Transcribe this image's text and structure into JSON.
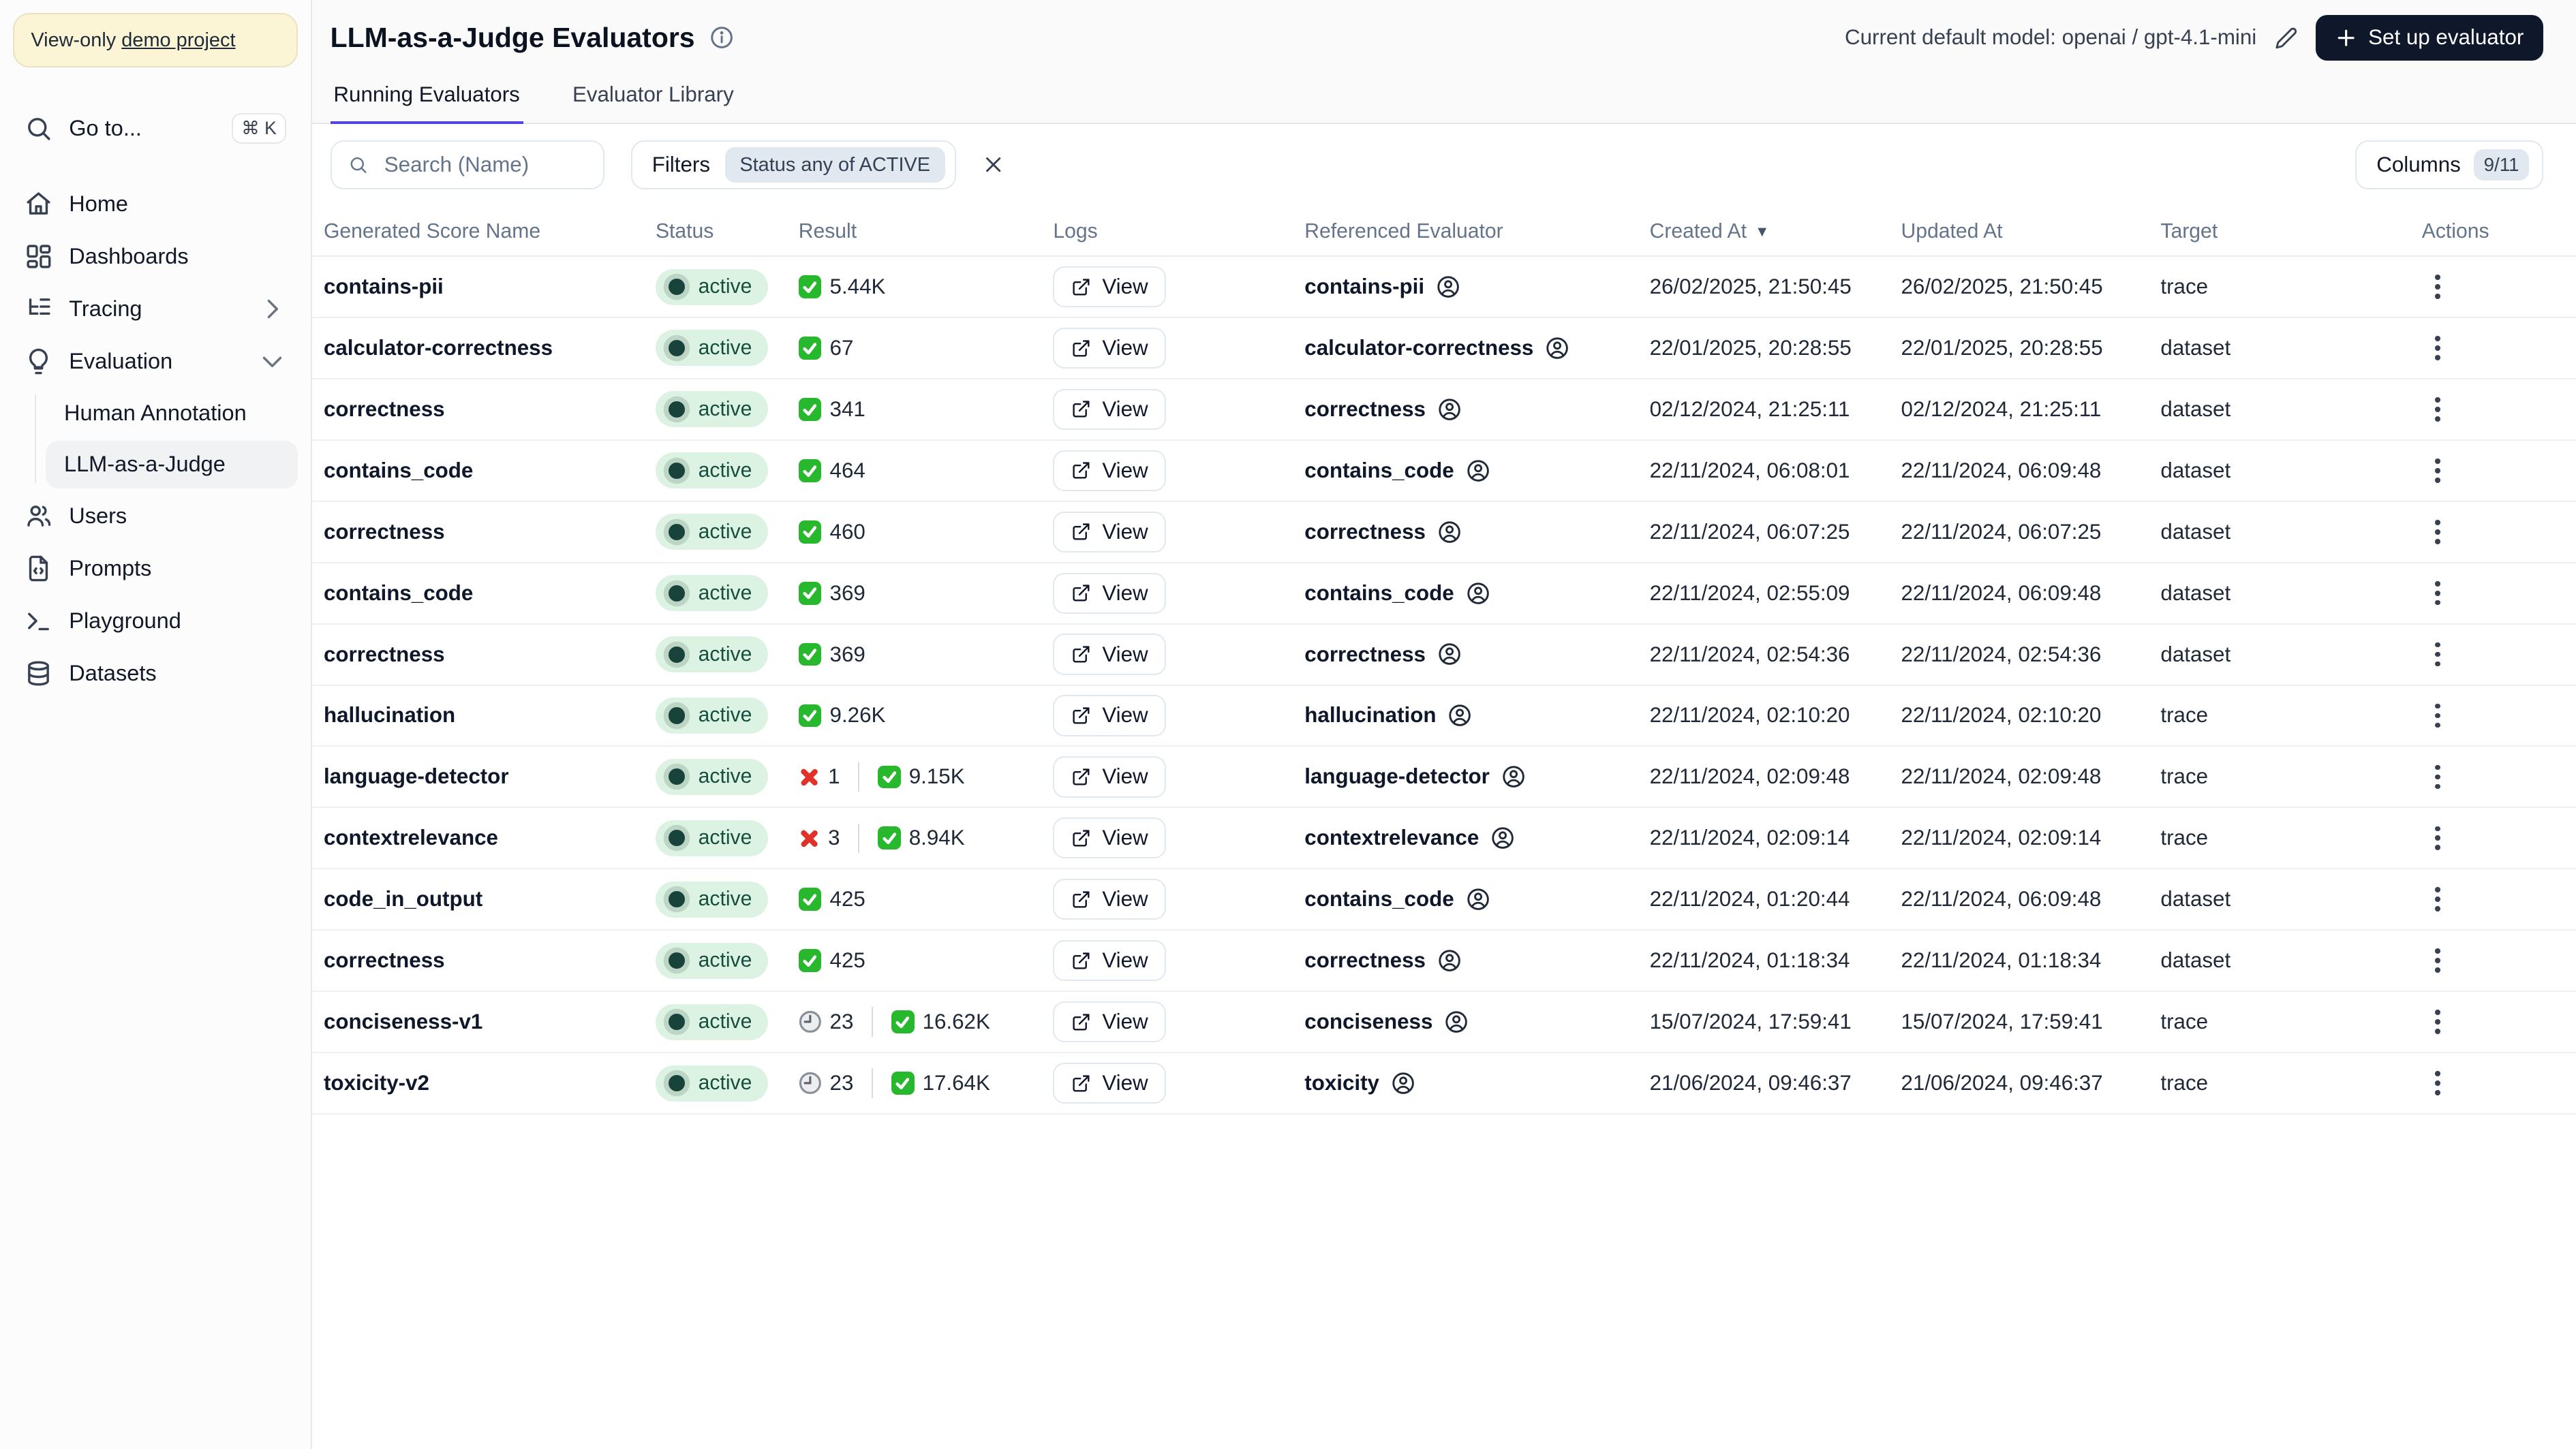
{
  "colors": {
    "accent": "#4f46e5",
    "status_active_bg": "#dcf3e4",
    "status_active_text": "#174f3f",
    "success_green": "#28b82e",
    "error_red": "#e0312a",
    "primary_button_bg": "#0f172a",
    "banner_bg": "#fbf4d5"
  },
  "sidebar": {
    "banner_text": "View-only",
    "banner_link": "demo project",
    "goto_label": "Go to...",
    "goto_shortcut": "⌘ K",
    "items": [
      {
        "label": "Home"
      },
      {
        "label": "Dashboards"
      },
      {
        "label": "Tracing"
      },
      {
        "label": "Evaluation"
      },
      {
        "label": "Users"
      },
      {
        "label": "Prompts"
      },
      {
        "label": "Playground"
      },
      {
        "label": "Datasets"
      }
    ],
    "evaluation_children": [
      {
        "label": "Human Annotation",
        "active": false
      },
      {
        "label": "LLM-as-a-Judge",
        "active": true
      }
    ]
  },
  "header": {
    "title": "LLM-as-a-Judge Evaluators",
    "model_label": "Current default model: openai / gpt-4.1-mini",
    "setup_button": "Set up evaluator"
  },
  "tabs": [
    {
      "label": "Running Evaluators",
      "active": true
    },
    {
      "label": "Evaluator Library",
      "active": false
    }
  ],
  "toolbar": {
    "search_placeholder": "Search (Name)",
    "filters_label": "Filters",
    "filter_chip": "Status any of ACTIVE",
    "columns_label": "Columns",
    "columns_badge": "9/11"
  },
  "table": {
    "columns": [
      "Generated Score Name",
      "Status",
      "Result",
      "Logs",
      "Referenced Evaluator",
      "Created At",
      "Updated At",
      "Target",
      "Actions"
    ],
    "sort_column": "Created At",
    "view_label": "View",
    "rows": [
      {
        "name": "contains-pii",
        "status": "active",
        "fail": null,
        "pending": null,
        "success": "5.44K",
        "evaluator": "contains-pii",
        "created": "26/02/2025, 21:50:45",
        "updated": "26/02/2025, 21:50:45",
        "target": "trace"
      },
      {
        "name": "calculator-correctness",
        "status": "active",
        "fail": null,
        "pending": null,
        "success": "67",
        "evaluator": "calculator-correctness",
        "created": "22/01/2025, 20:28:55",
        "updated": "22/01/2025, 20:28:55",
        "target": "dataset"
      },
      {
        "name": "correctness",
        "status": "active",
        "fail": null,
        "pending": null,
        "success": "341",
        "evaluator": "correctness",
        "created": "02/12/2024, 21:25:11",
        "updated": "02/12/2024, 21:25:11",
        "target": "dataset"
      },
      {
        "name": "contains_code",
        "status": "active",
        "fail": null,
        "pending": null,
        "success": "464",
        "evaluator": "contains_code",
        "created": "22/11/2024, 06:08:01",
        "updated": "22/11/2024, 06:09:48",
        "target": "dataset"
      },
      {
        "name": "correctness",
        "status": "active",
        "fail": null,
        "pending": null,
        "success": "460",
        "evaluator": "correctness",
        "created": "22/11/2024, 06:07:25",
        "updated": "22/11/2024, 06:07:25",
        "target": "dataset"
      },
      {
        "name": "contains_code",
        "status": "active",
        "fail": null,
        "pending": null,
        "success": "369",
        "evaluator": "contains_code",
        "created": "22/11/2024, 02:55:09",
        "updated": "22/11/2024, 06:09:48",
        "target": "dataset"
      },
      {
        "name": "correctness",
        "status": "active",
        "fail": null,
        "pending": null,
        "success": "369",
        "evaluator": "correctness",
        "created": "22/11/2024, 02:54:36",
        "updated": "22/11/2024, 02:54:36",
        "target": "dataset"
      },
      {
        "name": "hallucination",
        "status": "active",
        "fail": null,
        "pending": null,
        "success": "9.26K",
        "evaluator": "hallucination",
        "created": "22/11/2024, 02:10:20",
        "updated": "22/11/2024, 02:10:20",
        "target": "trace"
      },
      {
        "name": "language-detector",
        "status": "active",
        "fail": "1",
        "pending": null,
        "success": "9.15K",
        "evaluator": "language-detector",
        "created": "22/11/2024, 02:09:48",
        "updated": "22/11/2024, 02:09:48",
        "target": "trace"
      },
      {
        "name": "contextrelevance",
        "status": "active",
        "fail": "3",
        "pending": null,
        "success": "8.94K",
        "evaluator": "contextrelevance",
        "created": "22/11/2024, 02:09:14",
        "updated": "22/11/2024, 02:09:14",
        "target": "trace"
      },
      {
        "name": "code_in_output",
        "status": "active",
        "fail": null,
        "pending": null,
        "success": "425",
        "evaluator": "contains_code",
        "created": "22/11/2024, 01:20:44",
        "updated": "22/11/2024, 06:09:48",
        "target": "dataset"
      },
      {
        "name": "correctness",
        "status": "active",
        "fail": null,
        "pending": null,
        "success": "425",
        "evaluator": "correctness",
        "created": "22/11/2024, 01:18:34",
        "updated": "22/11/2024, 01:18:34",
        "target": "dataset"
      },
      {
        "name": "conciseness-v1",
        "status": "active",
        "fail": null,
        "pending": "23",
        "success": "16.62K",
        "evaluator": "conciseness",
        "created": "15/07/2024, 17:59:41",
        "updated": "15/07/2024, 17:59:41",
        "target": "trace"
      },
      {
        "name": "toxicity-v2",
        "status": "active",
        "fail": null,
        "pending": "23",
        "success": "17.64K",
        "evaluator": "toxicity",
        "created": "21/06/2024, 09:46:37",
        "updated": "21/06/2024, 09:46:37",
        "target": "trace"
      }
    ]
  }
}
